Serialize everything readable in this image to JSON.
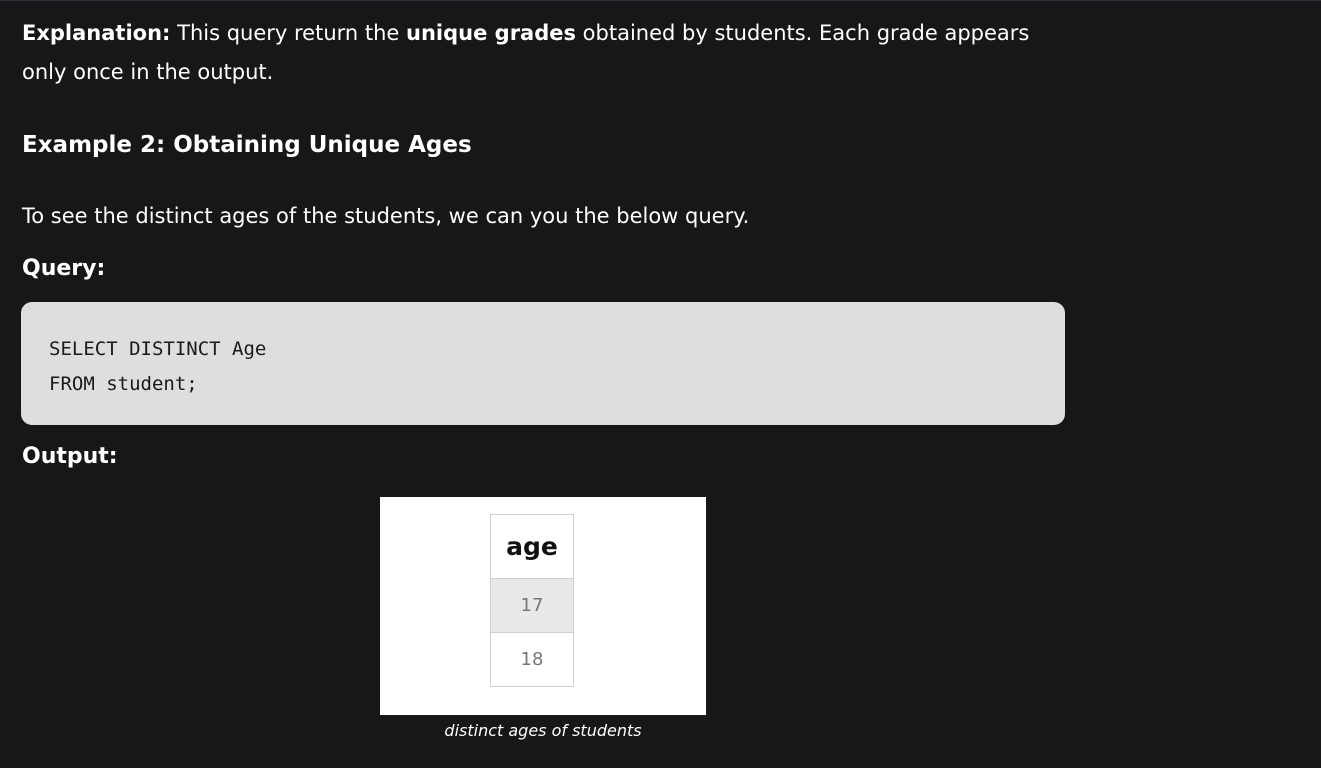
{
  "explanation": {
    "label": "Explanation:",
    "text_before": " This query return the ",
    "bold": "unique grades",
    "text_after": " obtained by students. Each grade appears only once in the output."
  },
  "example_heading": "Example 2: Obtaining Unique Ages",
  "intro_text": "To see the distinct ages of the students, we can you the below query.",
  "query_label": "Query:",
  "code_lines": [
    "SELECT DISTINCT Age",
    "FROM student;"
  ],
  "output_label": "Output:",
  "result_table": {
    "header": "age",
    "rows": [
      "17",
      "18"
    ]
  },
  "figure_caption": "distinct ages of students"
}
